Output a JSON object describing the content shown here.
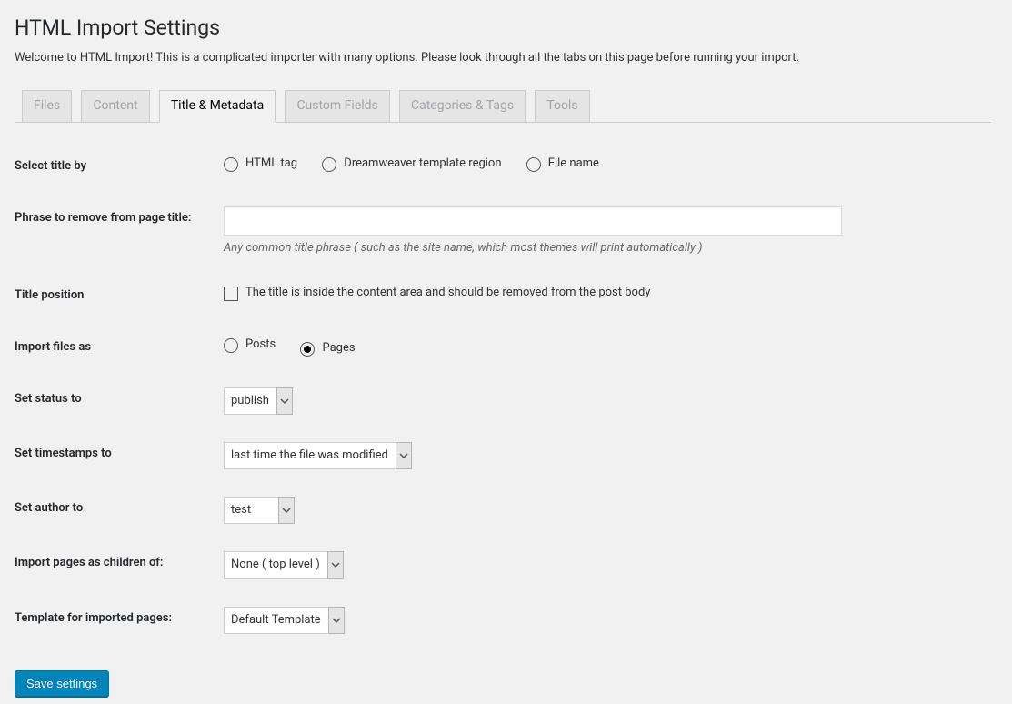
{
  "page": {
    "title": "HTML Import Settings",
    "intro": "Welcome to HTML Import! This is a complicated importer with many options. Please look through all the tabs on this page before running your import."
  },
  "tabs": [
    {
      "label": "Files",
      "active": false,
      "disabled": true
    },
    {
      "label": "Content",
      "active": false,
      "disabled": true
    },
    {
      "label": "Title & Metadata",
      "active": true,
      "disabled": false
    },
    {
      "label": "Custom Fields",
      "active": false,
      "disabled": true
    },
    {
      "label": "Categories & Tags",
      "active": false,
      "disabled": true
    },
    {
      "label": "Tools",
      "active": false,
      "disabled": true
    }
  ],
  "fields": {
    "select_title": {
      "label": "Select title by",
      "opt_html": "HTML tag",
      "opt_dw": "Dreamweaver template region",
      "opt_file": "File name"
    },
    "phrase": {
      "label": "Phrase to remove from page title:",
      "value": "",
      "help": "Any common title phrase ( such as the site name, which most themes will print automatically )"
    },
    "title_position": {
      "label": "Title position",
      "checkbox": "The title is inside the content area and should be removed from the post body"
    },
    "import_as": {
      "label": "Import files as",
      "opt_posts": "Posts",
      "opt_pages": "Pages"
    },
    "status": {
      "label": "Set status to",
      "value": "publish"
    },
    "timestamps": {
      "label": "Set timestamps to",
      "value": "last time the file was modified"
    },
    "author": {
      "label": "Set author to",
      "value": "test"
    },
    "parent": {
      "label": "Import pages as children of:",
      "value": "None ( top level )"
    },
    "template": {
      "label": "Template for imported pages:",
      "value": "Default Template"
    }
  },
  "submit": {
    "label": "Save settings"
  }
}
